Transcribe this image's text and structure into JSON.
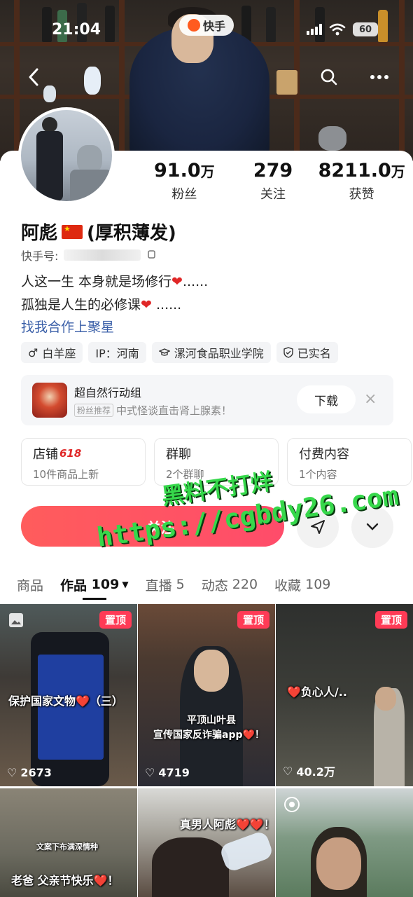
{
  "status": {
    "time": "21:04",
    "app_name": "快手",
    "battery": "60"
  },
  "profile": {
    "name": "阿彪",
    "name_suffix": "(厚积薄发)",
    "ks_id_label": "快手号:",
    "bio_lines": [
      "人这一生 本身就是场修行",
      "孤独是人生的必修课"
    ],
    "bio_ellipsis": "......",
    "business_link": "找我合作上聚星",
    "tags": [
      "白羊座",
      "IP：河南",
      "漯河食品职业学院",
      "已实名"
    ]
  },
  "stats": [
    {
      "num": "91.0",
      "unit": "万",
      "label": "粉丝"
    },
    {
      "num": "279",
      "unit": "",
      "label": "关注"
    },
    {
      "num": "8211.0",
      "unit": "万",
      "label": "获赞"
    }
  ],
  "ad": {
    "title": "超自然行动组",
    "badge": "粉丝推荐",
    "subtitle": "中式怪谈直击肾上腺素！",
    "download": "下载",
    "close": "×"
  },
  "boxes": [
    {
      "title": "店铺",
      "badge": "618",
      "sub": "10件商品上新"
    },
    {
      "title": "群聊",
      "badge": "",
      "sub": "2个群聊"
    },
    {
      "title": "付费内容",
      "badge": "",
      "sub": "1个内容"
    }
  ],
  "follow_button": "+ 关注",
  "watermark": {
    "line1": "黑料不打烊",
    "line2": "https://cgbdy26.com"
  },
  "tabs": [
    {
      "label": "商品",
      "count": ""
    },
    {
      "label": "作品",
      "count": "109"
    },
    {
      "label": "直播",
      "count": "5"
    },
    {
      "label": "动态",
      "count": "220"
    },
    {
      "label": "收藏",
      "count": "109"
    }
  ],
  "videos": [
    {
      "pinned": "置顶",
      "caption": "保护国家文物❤️（三）",
      "likes": "2673"
    },
    {
      "pinned": "置顶",
      "caption_line1": "平顶山叶县",
      "caption_line2": "宣传国家反诈骗app❤️！",
      "likes": "4719"
    },
    {
      "pinned": "置顶",
      "caption": "❤️负心人/..",
      "likes": "40.2万"
    },
    {
      "caption_small": "文案下布满深情种",
      "caption": "老爸 父亲节快乐❤️！"
    },
    {
      "caption": "真男人阿彪❤️❤️！"
    },
    {}
  ],
  "colors": {
    "accent": "#ff4c6a",
    "link": "#3a5fa8",
    "pin": "#ff3b56"
  }
}
